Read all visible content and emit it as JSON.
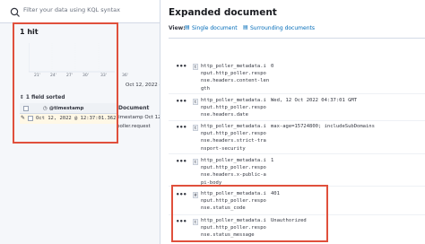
{
  "search": {
    "placeholder": "Filter your data using KQL syntax"
  },
  "results": {
    "hits": "1 hit",
    "date_label": "Oct 12, 2022 @",
    "document_header": "Document",
    "document_ts": "timestamp Oct 12",
    "document_frag": "poller.request",
    "sorted_label": "1 field sorted",
    "timestamp_header": "@timestamp",
    "row_timestamp": "Oct 12, 2022 @ 12:37:01.362"
  },
  "histogram": {
    "tick_labels": [
      "21'",
      "24'",
      "27'",
      "30'",
      "33'",
      "36'"
    ]
  },
  "flyout": {
    "title": "Expanded document",
    "view_label": "View:",
    "single_link": "Single document",
    "surrounding_link": "Surrounding documents",
    "fields": [
      {
        "type": "t",
        "name": "http_poller_metadata.i\nnput.http_poller.respo\nnse.headers.content-len\ngth",
        "value": "0"
      },
      {
        "type": "t",
        "name": "http_poller_metadata.i\nnput.http_poller.respo\nnse.headers.date",
        "value": "Wed, 12 Oct 2022 04:37:01 GMT"
      },
      {
        "type": "t",
        "name": "http_poller_metadata.i\nnput.http_poller.respo\nnse.headers.strict-tra\nnsport-security",
        "value": "max-age=15724800; includeSubDomains"
      },
      {
        "type": "t",
        "name": "http_poller_metadata.i\nnput.http_poller.respo\nnse.headers.x-public-a\npi-body",
        "value": "1"
      },
      {
        "type": "#",
        "name": "http_poller_metadata.i\nnput.http_poller.respo\nnse.status_code",
        "value": "401"
      },
      {
        "type": "t",
        "name": "http_poller_metadata.i\nnput.http_poller.respo\nnse.status_message",
        "value": "Unauthorized"
      }
    ]
  }
}
